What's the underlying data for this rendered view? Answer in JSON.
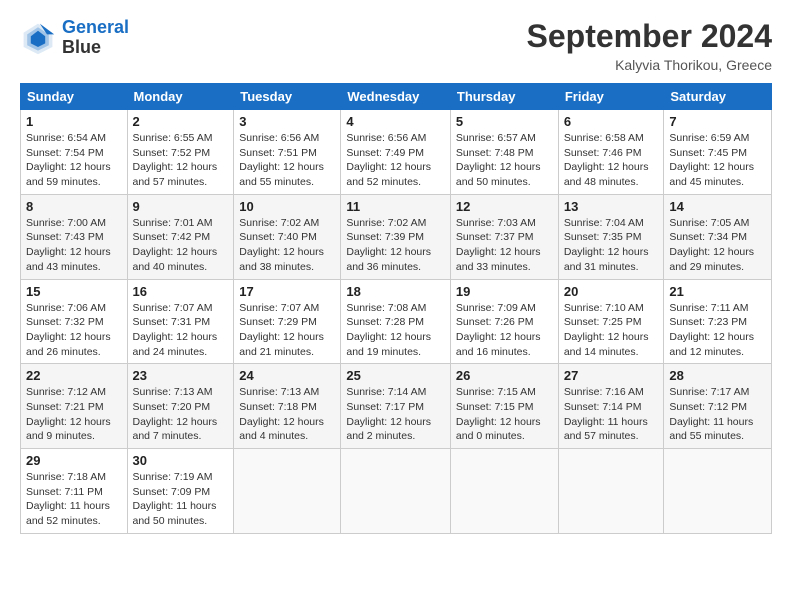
{
  "header": {
    "logo_line1": "General",
    "logo_line2": "Blue",
    "month": "September 2024",
    "location": "Kalyvia Thorikou, Greece"
  },
  "weekdays": [
    "Sunday",
    "Monday",
    "Tuesday",
    "Wednesday",
    "Thursday",
    "Friday",
    "Saturday"
  ],
  "weeks": [
    [
      {
        "day": "1",
        "info": "Sunrise: 6:54 AM\nSunset: 7:54 PM\nDaylight: 12 hours\nand 59 minutes."
      },
      {
        "day": "2",
        "info": "Sunrise: 6:55 AM\nSunset: 7:52 PM\nDaylight: 12 hours\nand 57 minutes."
      },
      {
        "day": "3",
        "info": "Sunrise: 6:56 AM\nSunset: 7:51 PM\nDaylight: 12 hours\nand 55 minutes."
      },
      {
        "day": "4",
        "info": "Sunrise: 6:56 AM\nSunset: 7:49 PM\nDaylight: 12 hours\nand 52 minutes."
      },
      {
        "day": "5",
        "info": "Sunrise: 6:57 AM\nSunset: 7:48 PM\nDaylight: 12 hours\nand 50 minutes."
      },
      {
        "day": "6",
        "info": "Sunrise: 6:58 AM\nSunset: 7:46 PM\nDaylight: 12 hours\nand 48 minutes."
      },
      {
        "day": "7",
        "info": "Sunrise: 6:59 AM\nSunset: 7:45 PM\nDaylight: 12 hours\nand 45 minutes."
      }
    ],
    [
      {
        "day": "8",
        "info": "Sunrise: 7:00 AM\nSunset: 7:43 PM\nDaylight: 12 hours\nand 43 minutes."
      },
      {
        "day": "9",
        "info": "Sunrise: 7:01 AM\nSunset: 7:42 PM\nDaylight: 12 hours\nand 40 minutes."
      },
      {
        "day": "10",
        "info": "Sunrise: 7:02 AM\nSunset: 7:40 PM\nDaylight: 12 hours\nand 38 minutes."
      },
      {
        "day": "11",
        "info": "Sunrise: 7:02 AM\nSunset: 7:39 PM\nDaylight: 12 hours\nand 36 minutes."
      },
      {
        "day": "12",
        "info": "Sunrise: 7:03 AM\nSunset: 7:37 PM\nDaylight: 12 hours\nand 33 minutes."
      },
      {
        "day": "13",
        "info": "Sunrise: 7:04 AM\nSunset: 7:35 PM\nDaylight: 12 hours\nand 31 minutes."
      },
      {
        "day": "14",
        "info": "Sunrise: 7:05 AM\nSunset: 7:34 PM\nDaylight: 12 hours\nand 29 minutes."
      }
    ],
    [
      {
        "day": "15",
        "info": "Sunrise: 7:06 AM\nSunset: 7:32 PM\nDaylight: 12 hours\nand 26 minutes."
      },
      {
        "day": "16",
        "info": "Sunrise: 7:07 AM\nSunset: 7:31 PM\nDaylight: 12 hours\nand 24 minutes."
      },
      {
        "day": "17",
        "info": "Sunrise: 7:07 AM\nSunset: 7:29 PM\nDaylight: 12 hours\nand 21 minutes."
      },
      {
        "day": "18",
        "info": "Sunrise: 7:08 AM\nSunset: 7:28 PM\nDaylight: 12 hours\nand 19 minutes."
      },
      {
        "day": "19",
        "info": "Sunrise: 7:09 AM\nSunset: 7:26 PM\nDaylight: 12 hours\nand 16 minutes."
      },
      {
        "day": "20",
        "info": "Sunrise: 7:10 AM\nSunset: 7:25 PM\nDaylight: 12 hours\nand 14 minutes."
      },
      {
        "day": "21",
        "info": "Sunrise: 7:11 AM\nSunset: 7:23 PM\nDaylight: 12 hours\nand 12 minutes."
      }
    ],
    [
      {
        "day": "22",
        "info": "Sunrise: 7:12 AM\nSunset: 7:21 PM\nDaylight: 12 hours\nand 9 minutes."
      },
      {
        "day": "23",
        "info": "Sunrise: 7:13 AM\nSunset: 7:20 PM\nDaylight: 12 hours\nand 7 minutes."
      },
      {
        "day": "24",
        "info": "Sunrise: 7:13 AM\nSunset: 7:18 PM\nDaylight: 12 hours\nand 4 minutes."
      },
      {
        "day": "25",
        "info": "Sunrise: 7:14 AM\nSunset: 7:17 PM\nDaylight: 12 hours\nand 2 minutes."
      },
      {
        "day": "26",
        "info": "Sunrise: 7:15 AM\nSunset: 7:15 PM\nDaylight: 12 hours\nand 0 minutes."
      },
      {
        "day": "27",
        "info": "Sunrise: 7:16 AM\nSunset: 7:14 PM\nDaylight: 11 hours\nand 57 minutes."
      },
      {
        "day": "28",
        "info": "Sunrise: 7:17 AM\nSunset: 7:12 PM\nDaylight: 11 hours\nand 55 minutes."
      }
    ],
    [
      {
        "day": "29",
        "info": "Sunrise: 7:18 AM\nSunset: 7:11 PM\nDaylight: 11 hours\nand 52 minutes."
      },
      {
        "day": "30",
        "info": "Sunrise: 7:19 AM\nSunset: 7:09 PM\nDaylight: 11 hours\nand 50 minutes."
      },
      {
        "day": "",
        "info": ""
      },
      {
        "day": "",
        "info": ""
      },
      {
        "day": "",
        "info": ""
      },
      {
        "day": "",
        "info": ""
      },
      {
        "day": "",
        "info": ""
      }
    ]
  ]
}
